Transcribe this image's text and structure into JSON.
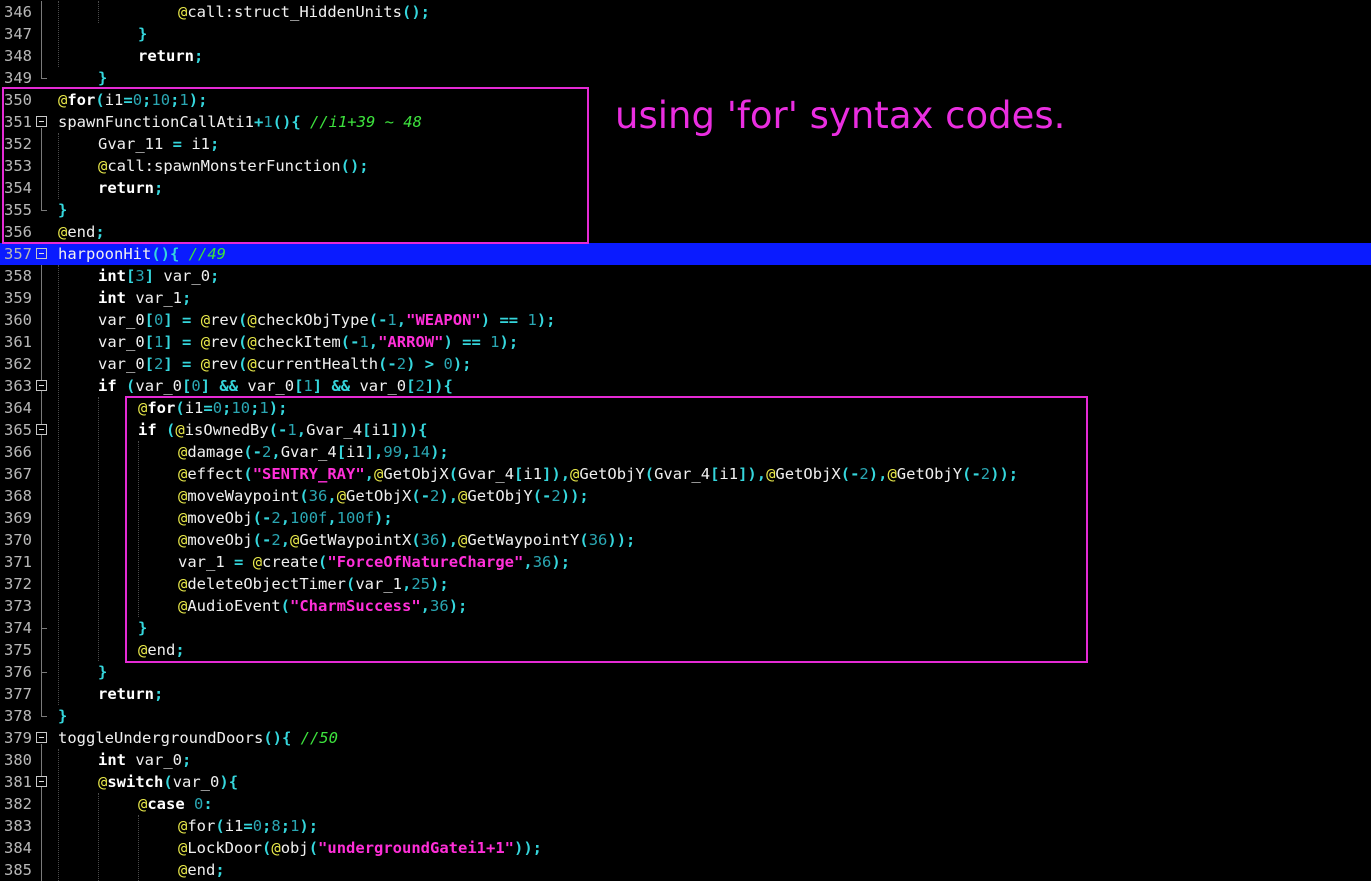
{
  "annotation": "using 'for' syntax codes.",
  "colors": {
    "background": "#000000",
    "current_line": "#0a1bff",
    "highlight_box": "#e52ad5",
    "keyword": "#ffffff",
    "at_prefix": "#e8e84a",
    "punctuation": "#35d6dc",
    "number": "#2aa7b3",
    "string": "#ff2fd8",
    "comment": "#3de23d"
  },
  "lines": [
    {
      "no": "346",
      "indent": 3,
      "tokens": [
        [
          "a",
          "@"
        ],
        [
          "w",
          "call:struct_HiddenUnits"
        ],
        [
          "p",
          "();"
        ]
      ]
    },
    {
      "no": "347",
      "indent": 2,
      "tokens": [
        [
          "p",
          "}"
        ]
      ]
    },
    {
      "no": "348",
      "indent": 2,
      "tokens": [
        [
          "k",
          "return"
        ],
        [
          "p",
          ";"
        ]
      ]
    },
    {
      "no": "349",
      "indent": 1,
      "tokens": [
        [
          "p",
          "}"
        ]
      ]
    },
    {
      "no": "350",
      "indent": 0,
      "tokens": [
        [
          "a",
          "@"
        ],
        [
          "k",
          "for"
        ],
        [
          "p",
          "("
        ],
        [
          "w",
          "i1"
        ],
        [
          "p",
          "="
        ],
        [
          "n",
          "0"
        ],
        [
          "p",
          ";"
        ],
        [
          "n",
          "10"
        ],
        [
          "p",
          ";"
        ],
        [
          "n",
          "1"
        ],
        [
          "p",
          ");"
        ]
      ]
    },
    {
      "no": "351",
      "indent": 0,
      "fold": true,
      "tokens": [
        [
          "w",
          "spawnFunctionCallAti1"
        ],
        [
          "p",
          "+"
        ],
        [
          "n",
          "1"
        ],
        [
          "p",
          "(){ "
        ],
        [
          "c",
          "//i1+39 ~ 48"
        ]
      ]
    },
    {
      "no": "352",
      "indent": 1,
      "tokens": [
        [
          "w",
          "Gvar_11 "
        ],
        [
          "p",
          "="
        ],
        [
          "w",
          " i1"
        ],
        [
          "p",
          ";"
        ]
      ]
    },
    {
      "no": "353",
      "indent": 1,
      "tokens": [
        [
          "a",
          "@"
        ],
        [
          "w",
          "call:spawnMonsterFunction"
        ],
        [
          "p",
          "();"
        ]
      ]
    },
    {
      "no": "354",
      "indent": 1,
      "tokens": [
        [
          "k",
          "return"
        ],
        [
          "p",
          ";"
        ]
      ]
    },
    {
      "no": "355",
      "indent": 0,
      "tokens": [
        [
          "p",
          "}"
        ]
      ]
    },
    {
      "no": "356",
      "indent": 0,
      "tokens": [
        [
          "a",
          "@"
        ],
        [
          "w",
          "end"
        ],
        [
          "p",
          ";"
        ]
      ]
    },
    {
      "no": "357",
      "indent": 0,
      "fold": true,
      "current": true,
      "tokens": [
        [
          "w",
          "harpoonHit"
        ],
        [
          "p",
          "(){ "
        ],
        [
          "c",
          "//49"
        ]
      ]
    },
    {
      "no": "358",
      "indent": 1,
      "tokens": [
        [
          "k",
          "int"
        ],
        [
          "p",
          "["
        ],
        [
          "n",
          "3"
        ],
        [
          "p",
          "]"
        ],
        [
          "w",
          " var_0"
        ],
        [
          "p",
          ";"
        ]
      ]
    },
    {
      "no": "359",
      "indent": 1,
      "tokens": [
        [
          "k",
          "int"
        ],
        [
          "w",
          " var_1"
        ],
        [
          "p",
          ";"
        ]
      ]
    },
    {
      "no": "360",
      "indent": 1,
      "tokens": [
        [
          "w",
          "var_0"
        ],
        [
          "p",
          "["
        ],
        [
          "n",
          "0"
        ],
        [
          "p",
          "]"
        ],
        [
          "w",
          " "
        ],
        [
          "p",
          "="
        ],
        [
          "w",
          " "
        ],
        [
          "a",
          "@"
        ],
        [
          "w",
          "rev"
        ],
        [
          "p",
          "("
        ],
        [
          "a",
          "@"
        ],
        [
          "w",
          "checkObjType"
        ],
        [
          "p",
          "(-"
        ],
        [
          "n",
          "1"
        ],
        [
          "p",
          ","
        ],
        [
          "s",
          "\"WEAPON\""
        ],
        [
          "p",
          ")"
        ],
        [
          "w",
          " "
        ],
        [
          "p",
          "=="
        ],
        [
          "w",
          " "
        ],
        [
          "n",
          "1"
        ],
        [
          "p",
          ");"
        ]
      ]
    },
    {
      "no": "361",
      "indent": 1,
      "tokens": [
        [
          "w",
          "var_0"
        ],
        [
          "p",
          "["
        ],
        [
          "n",
          "1"
        ],
        [
          "p",
          "]"
        ],
        [
          "w",
          " "
        ],
        [
          "p",
          "="
        ],
        [
          "w",
          " "
        ],
        [
          "a",
          "@"
        ],
        [
          "w",
          "rev"
        ],
        [
          "p",
          "("
        ],
        [
          "a",
          "@"
        ],
        [
          "w",
          "checkItem"
        ],
        [
          "p",
          "(-"
        ],
        [
          "n",
          "1"
        ],
        [
          "p",
          ","
        ],
        [
          "s",
          "\"ARROW\""
        ],
        [
          "p",
          ")"
        ],
        [
          "w",
          " "
        ],
        [
          "p",
          "=="
        ],
        [
          "w",
          " "
        ],
        [
          "n",
          "1"
        ],
        [
          "p",
          ");"
        ]
      ]
    },
    {
      "no": "362",
      "indent": 1,
      "tokens": [
        [
          "w",
          "var_0"
        ],
        [
          "p",
          "["
        ],
        [
          "n",
          "2"
        ],
        [
          "p",
          "]"
        ],
        [
          "w",
          " "
        ],
        [
          "p",
          "="
        ],
        [
          "w",
          " "
        ],
        [
          "a",
          "@"
        ],
        [
          "w",
          "rev"
        ],
        [
          "p",
          "("
        ],
        [
          "a",
          "@"
        ],
        [
          "w",
          "currentHealth"
        ],
        [
          "p",
          "(-"
        ],
        [
          "n",
          "2"
        ],
        [
          "p",
          ")"
        ],
        [
          "w",
          " "
        ],
        [
          "p",
          ">"
        ],
        [
          "w",
          " "
        ],
        [
          "n",
          "0"
        ],
        [
          "p",
          ");"
        ]
      ]
    },
    {
      "no": "363",
      "indent": 1,
      "fold": true,
      "tokens": [
        [
          "k",
          "if"
        ],
        [
          "w",
          " "
        ],
        [
          "p",
          "("
        ],
        [
          "w",
          "var_0"
        ],
        [
          "p",
          "["
        ],
        [
          "n",
          "0"
        ],
        [
          "p",
          "]"
        ],
        [
          "w",
          " "
        ],
        [
          "p",
          "&&"
        ],
        [
          "w",
          " var_0"
        ],
        [
          "p",
          "["
        ],
        [
          "n",
          "1"
        ],
        [
          "p",
          "]"
        ],
        [
          "w",
          " "
        ],
        [
          "p",
          "&&"
        ],
        [
          "w",
          " var_0"
        ],
        [
          "p",
          "["
        ],
        [
          "n",
          "2"
        ],
        [
          "p",
          "]){"
        ]
      ]
    },
    {
      "no": "364",
      "indent": 2,
      "tokens": [
        [
          "a",
          "@"
        ],
        [
          "k",
          "for"
        ],
        [
          "p",
          "("
        ],
        [
          "w",
          "i1"
        ],
        [
          "p",
          "="
        ],
        [
          "n",
          "0"
        ],
        [
          "p",
          ";"
        ],
        [
          "n",
          "10"
        ],
        [
          "p",
          ";"
        ],
        [
          "n",
          "1"
        ],
        [
          "p",
          ");"
        ]
      ]
    },
    {
      "no": "365",
      "indent": 2,
      "fold": true,
      "tokens": [
        [
          "k",
          "if"
        ],
        [
          "w",
          " "
        ],
        [
          "p",
          "("
        ],
        [
          "a",
          "@"
        ],
        [
          "w",
          "isOwnedBy"
        ],
        [
          "p",
          "(-"
        ],
        [
          "n",
          "1"
        ],
        [
          "p",
          ","
        ],
        [
          "w",
          "Gvar_4"
        ],
        [
          "p",
          "["
        ],
        [
          "w",
          "i1"
        ],
        [
          "p",
          "])){"
        ]
      ]
    },
    {
      "no": "366",
      "indent": 3,
      "tokens": [
        [
          "a",
          "@"
        ],
        [
          "w",
          "damage"
        ],
        [
          "p",
          "(-"
        ],
        [
          "n",
          "2"
        ],
        [
          "p",
          ","
        ],
        [
          "w",
          "Gvar_4"
        ],
        [
          "p",
          "["
        ],
        [
          "w",
          "i1"
        ],
        [
          "p",
          "],"
        ],
        [
          "n",
          "99"
        ],
        [
          "p",
          ","
        ],
        [
          "n",
          "14"
        ],
        [
          "p",
          ");"
        ]
      ]
    },
    {
      "no": "367",
      "indent": 3,
      "tokens": [
        [
          "a",
          "@"
        ],
        [
          "w",
          "effect"
        ],
        [
          "p",
          "("
        ],
        [
          "s",
          "\"SENTRY_RAY\""
        ],
        [
          "p",
          ","
        ],
        [
          "a",
          "@"
        ],
        [
          "w",
          "GetObjX"
        ],
        [
          "p",
          "("
        ],
        [
          "w",
          "Gvar_4"
        ],
        [
          "p",
          "["
        ],
        [
          "w",
          "i1"
        ],
        [
          "p",
          "]),"
        ],
        [
          "a",
          "@"
        ],
        [
          "w",
          "GetObjY"
        ],
        [
          "p",
          "("
        ],
        [
          "w",
          "Gvar_4"
        ],
        [
          "p",
          "["
        ],
        [
          "w",
          "i1"
        ],
        [
          "p",
          "]),"
        ],
        [
          "a",
          "@"
        ],
        [
          "w",
          "GetObjX"
        ],
        [
          "p",
          "(-"
        ],
        [
          "n",
          "2"
        ],
        [
          "p",
          "),"
        ],
        [
          "a",
          "@"
        ],
        [
          "w",
          "GetObjY"
        ],
        [
          "p",
          "(-"
        ],
        [
          "n",
          "2"
        ],
        [
          "p",
          "));"
        ]
      ]
    },
    {
      "no": "368",
      "indent": 3,
      "tokens": [
        [
          "a",
          "@"
        ],
        [
          "w",
          "moveWaypoint"
        ],
        [
          "p",
          "("
        ],
        [
          "n",
          "36"
        ],
        [
          "p",
          ","
        ],
        [
          "a",
          "@"
        ],
        [
          "w",
          "GetObjX"
        ],
        [
          "p",
          "(-"
        ],
        [
          "n",
          "2"
        ],
        [
          "p",
          "),"
        ],
        [
          "a",
          "@"
        ],
        [
          "w",
          "GetObjY"
        ],
        [
          "p",
          "(-"
        ],
        [
          "n",
          "2"
        ],
        [
          "p",
          "));"
        ]
      ]
    },
    {
      "no": "369",
      "indent": 3,
      "tokens": [
        [
          "a",
          "@"
        ],
        [
          "w",
          "moveObj"
        ],
        [
          "p",
          "(-"
        ],
        [
          "n",
          "2"
        ],
        [
          "p",
          ","
        ],
        [
          "n",
          "100f"
        ],
        [
          "p",
          ","
        ],
        [
          "n",
          "100f"
        ],
        [
          "p",
          ");"
        ]
      ]
    },
    {
      "no": "370",
      "indent": 3,
      "tokens": [
        [
          "a",
          "@"
        ],
        [
          "w",
          "moveObj"
        ],
        [
          "p",
          "(-"
        ],
        [
          "n",
          "2"
        ],
        [
          "p",
          ","
        ],
        [
          "a",
          "@"
        ],
        [
          "w",
          "GetWaypointX"
        ],
        [
          "p",
          "("
        ],
        [
          "n",
          "36"
        ],
        [
          "p",
          "),"
        ],
        [
          "a",
          "@"
        ],
        [
          "w",
          "GetWaypointY"
        ],
        [
          "p",
          "("
        ],
        [
          "n",
          "36"
        ],
        [
          "p",
          "));"
        ]
      ]
    },
    {
      "no": "371",
      "indent": 3,
      "tokens": [
        [
          "w",
          "var_1 "
        ],
        [
          "p",
          "="
        ],
        [
          "w",
          " "
        ],
        [
          "a",
          "@"
        ],
        [
          "w",
          "create"
        ],
        [
          "p",
          "("
        ],
        [
          "s",
          "\"ForceOfNatureCharge\""
        ],
        [
          "p",
          ","
        ],
        [
          "n",
          "36"
        ],
        [
          "p",
          ");"
        ]
      ]
    },
    {
      "no": "372",
      "indent": 3,
      "tokens": [
        [
          "a",
          "@"
        ],
        [
          "w",
          "deleteObjectTimer"
        ],
        [
          "p",
          "("
        ],
        [
          "w",
          "var_1"
        ],
        [
          "p",
          ","
        ],
        [
          "n",
          "25"
        ],
        [
          "p",
          ");"
        ]
      ]
    },
    {
      "no": "373",
      "indent": 3,
      "tokens": [
        [
          "a",
          "@"
        ],
        [
          "w",
          "AudioEvent"
        ],
        [
          "p",
          "("
        ],
        [
          "s",
          "\"CharmSuccess\""
        ],
        [
          "p",
          ","
        ],
        [
          "n",
          "36"
        ],
        [
          "p",
          ");"
        ]
      ]
    },
    {
      "no": "374",
      "indent": 2,
      "tokens": [
        [
          "p",
          "}"
        ]
      ]
    },
    {
      "no": "375",
      "indent": 2,
      "tokens": [
        [
          "a",
          "@"
        ],
        [
          "w",
          "end"
        ],
        [
          "p",
          ";"
        ]
      ]
    },
    {
      "no": "376",
      "indent": 1,
      "tokens": [
        [
          "p",
          "}"
        ]
      ]
    },
    {
      "no": "377",
      "indent": 1,
      "tokens": [
        [
          "k",
          "return"
        ],
        [
          "p",
          ";"
        ]
      ]
    },
    {
      "no": "378",
      "indent": 0,
      "tokens": [
        [
          "p",
          "}"
        ]
      ]
    },
    {
      "no": "379",
      "indent": 0,
      "fold": true,
      "tokens": [
        [
          "w",
          "toggleUndergroundDoors"
        ],
        [
          "p",
          "(){ "
        ],
        [
          "c",
          "//50"
        ]
      ]
    },
    {
      "no": "380",
      "indent": 1,
      "tokens": [
        [
          "k",
          "int"
        ],
        [
          "w",
          " var_0"
        ],
        [
          "p",
          ";"
        ]
      ]
    },
    {
      "no": "381",
      "indent": 1,
      "fold": true,
      "tokens": [
        [
          "a",
          "@"
        ],
        [
          "k",
          "switch"
        ],
        [
          "p",
          "("
        ],
        [
          "w",
          "var_0"
        ],
        [
          "p",
          "){"
        ]
      ]
    },
    {
      "no": "382",
      "indent": 2,
      "tokens": [
        [
          "a",
          "@"
        ],
        [
          "k",
          "case"
        ],
        [
          "w",
          " "
        ],
        [
          "n",
          "0"
        ],
        [
          "p",
          ":"
        ]
      ]
    },
    {
      "no": "383",
      "indent": 3,
      "tokens": [
        [
          "a",
          "@"
        ],
        [
          "w",
          "for"
        ],
        [
          "p",
          "("
        ],
        [
          "w",
          "i1"
        ],
        [
          "p",
          "="
        ],
        [
          "n",
          "0"
        ],
        [
          "p",
          ";"
        ],
        [
          "n",
          "8"
        ],
        [
          "p",
          ";"
        ],
        [
          "n",
          "1"
        ],
        [
          "p",
          ");"
        ]
      ]
    },
    {
      "no": "384",
      "indent": 3,
      "tokens": [
        [
          "a",
          "@"
        ],
        [
          "w",
          "LockDoor"
        ],
        [
          "p",
          "("
        ],
        [
          "a",
          "@"
        ],
        [
          "w",
          "obj"
        ],
        [
          "p",
          "("
        ],
        [
          "s",
          "\"undergroundGatei1+1\""
        ],
        [
          "p",
          "));"
        ]
      ]
    },
    {
      "no": "385",
      "indent": 3,
      "tokens": [
        [
          "a",
          "@"
        ],
        [
          "w",
          "end"
        ],
        [
          "p",
          ";"
        ]
      ]
    }
  ]
}
